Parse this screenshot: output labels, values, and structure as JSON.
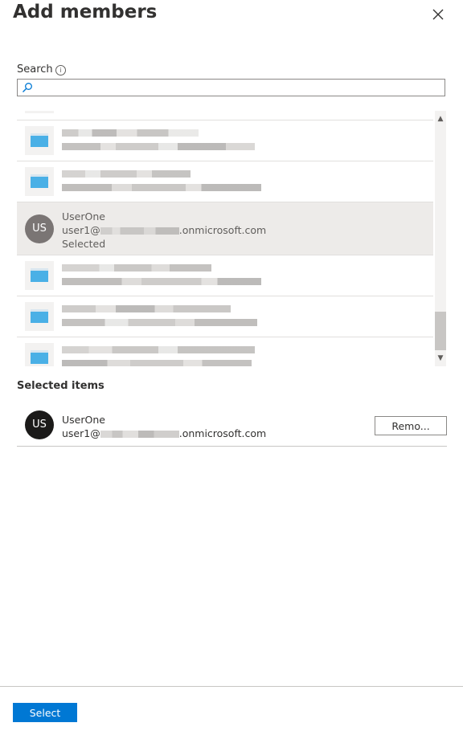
{
  "panel": {
    "title": "Add members",
    "close_icon": "close-icon"
  },
  "search": {
    "label": "Search",
    "placeholder": "",
    "value": ""
  },
  "results": [
    {
      "type": "app",
      "blurred": true,
      "selected": false
    },
    {
      "type": "app",
      "blurred": true,
      "selected": false
    },
    {
      "type": "user",
      "initials": "US",
      "name": "UserOne",
      "email_prefix": "user1@",
      "email_suffix": ".onmicrosoft.com",
      "status": "Selected",
      "selected": true
    },
    {
      "type": "app",
      "blurred": true,
      "selected": false
    },
    {
      "type": "app",
      "blurred": true,
      "selected": false
    },
    {
      "type": "app",
      "blurred": true,
      "selected": false
    }
  ],
  "selected_items": {
    "header": "Selected items",
    "items": [
      {
        "initials": "US",
        "name": "UserOne",
        "email_prefix": "user1@",
        "email_suffix": ".onmicrosoft.com",
        "remove_label": "Remo..."
      }
    ]
  },
  "footer": {
    "select_label": "Select"
  },
  "colors": {
    "accent": "#0078d4",
    "selected_row": "#edebe9",
    "avatar_selected_list": "#7a7574",
    "avatar_selected_items": "#1b1a19"
  }
}
